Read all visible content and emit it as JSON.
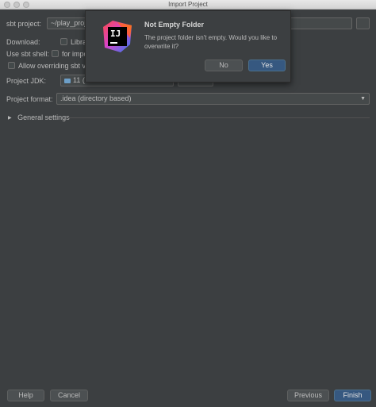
{
  "window": {
    "title": "Import Project"
  },
  "form": {
    "sbt_project_label": "sbt project:",
    "sbt_project_value": "~/play_proje",
    "download_label": "Download:",
    "download_option": "Libra",
    "use_sbt_shell_label": "Use sbt shell:",
    "use_sbt_shell_option": "for impo",
    "allow_overriding_label": "Allow overriding sbt v",
    "project_jdk_label": "Project JDK:",
    "project_jdk_value": "11 (",
    "project_format_label": "Project format:",
    "project_format_value": ".idea (directory based)",
    "general_settings_label": "General settings"
  },
  "dialog": {
    "title": "Not Empty Folder",
    "message": "The project folder isn't empty. Would you like to overwrite it?",
    "no_label": "No",
    "yes_label": "Yes",
    "logo_text": "IJ"
  },
  "footer": {
    "help_label": "Help",
    "cancel_label": "Cancel",
    "previous_label": "Previous",
    "finish_label": "Finish"
  },
  "colors": {
    "background": "#3c3f41",
    "primary_button": "#365880",
    "text": "#bbbbbb"
  }
}
